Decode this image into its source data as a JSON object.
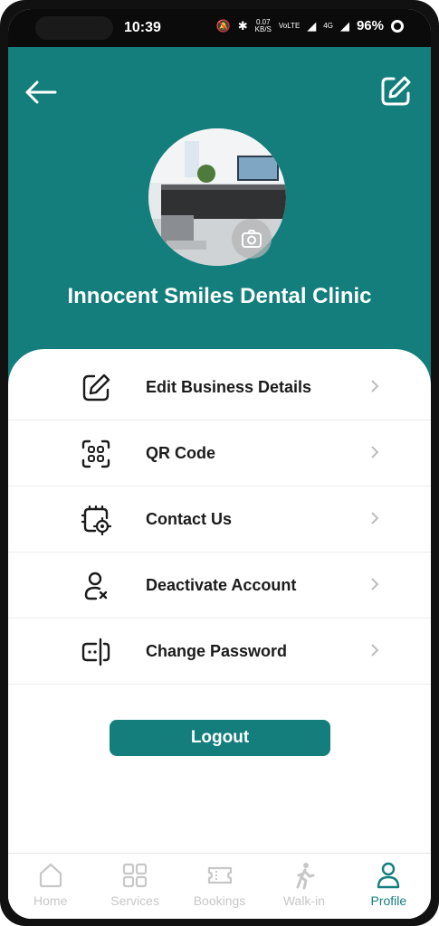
{
  "status_bar": {
    "time": "10:39",
    "net_speed": "0.07",
    "net_unit": "KB/S",
    "volte": "VoLTE",
    "network": "4G",
    "battery": "96%"
  },
  "header": {
    "back_icon": "arrow-left-icon",
    "edit_icon": "edit-square-icon",
    "clinic_name": "Innocent Smiles Dental Clinic",
    "photo_icon": "camera-icon"
  },
  "menu": {
    "items": [
      {
        "label": "Edit Business Details",
        "icon": "edit-square-icon"
      },
      {
        "label": "QR Code",
        "icon": "qr-code-icon"
      },
      {
        "label": "Contact Us",
        "icon": "support-gear-icon"
      },
      {
        "label": "Deactivate Account",
        "icon": "user-remove-icon"
      },
      {
        "label": "Change Password",
        "icon": "password-icon"
      }
    ]
  },
  "logout_label": "Logout",
  "tabs": [
    {
      "label": "Home",
      "icon": "home-icon",
      "active": false
    },
    {
      "label": "Services",
      "icon": "grid-icon",
      "active": false
    },
    {
      "label": "Bookings",
      "icon": "ticket-icon",
      "active": false
    },
    {
      "label": "Walk-in",
      "icon": "walking-icon",
      "active": false
    },
    {
      "label": "Profile",
      "icon": "person-icon",
      "active": true
    }
  ],
  "colors": {
    "primary": "#137e7c",
    "inactive_tab": "#c7c7c7"
  }
}
